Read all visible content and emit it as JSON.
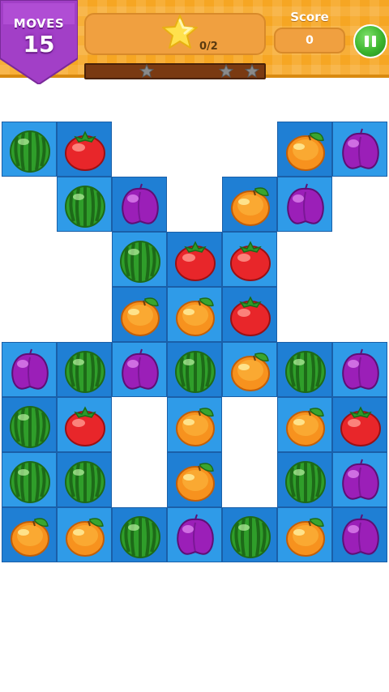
{
  "hud": {
    "moves_label": "MOVES",
    "moves_value": "15",
    "goal_count": "0/2",
    "score_label": "Score",
    "score_value": "0",
    "progress": 0,
    "pause_icon": "pause-icon",
    "goal_icon": "star-icon",
    "progress_star_icon": "star-icon"
  },
  "colors": {
    "hud_background": "#f6a623",
    "moves_badge": "#a23fc7",
    "board_light": "#2f9be8",
    "board_dark": "#1f7fd4",
    "pause_button": "#3cb52e"
  },
  "board": {
    "columns": 7,
    "rows": 8,
    "legend": {
      "W": "watermelon",
      "T": "tomato",
      "O": "orange",
      "P": "plum",
      "-": "empty"
    },
    "grid": [
      [
        "W",
        "T",
        "-",
        "-",
        "-",
        "O",
        "P"
      ],
      [
        "-",
        "W",
        "P",
        "-",
        "O",
        "P",
        "-"
      ],
      [
        "-",
        "-",
        "W",
        "T",
        "T",
        "-",
        "-"
      ],
      [
        "-",
        "-",
        "O",
        "O",
        "T",
        "-",
        "-"
      ],
      [
        "P",
        "W",
        "P",
        "W",
        "O",
        "W",
        "P"
      ],
      [
        "W",
        "T",
        "-",
        "O",
        "-",
        "O",
        "T"
      ],
      [
        "W",
        "W",
        "-",
        "O",
        "-",
        "W",
        "P"
      ],
      [
        "O",
        "O",
        "W",
        "P",
        "W",
        "O",
        "P"
      ]
    ]
  }
}
